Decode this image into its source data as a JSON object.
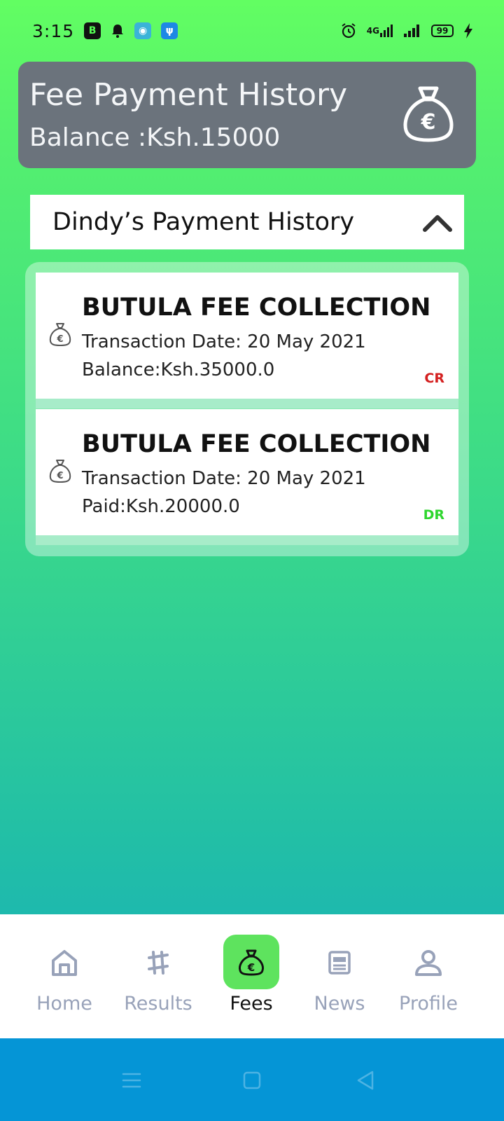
{
  "status_bar": {
    "time": "3:15",
    "network_label": "4G",
    "battery": "99"
  },
  "header": {
    "title": "Fee Payment History",
    "balance": "Balance :Ksh.15000",
    "icon": "money-bag-euro-icon"
  },
  "section": {
    "title": "Dindy’s Payment History",
    "toggle_icon": "chevron-up-icon"
  },
  "transactions": [
    {
      "title": "BUTULA FEE COLLECTION",
      "date": "Transaction Date: 20 May 2021",
      "amount": "Balance:Ksh.35000.0",
      "tag": "CR",
      "tag_color": "#d42020"
    },
    {
      "title": "BUTULA FEE COLLECTION",
      "date": "Transaction Date: 20 May 2021",
      "amount": "Paid:Ksh.20000.0",
      "tag": "DR",
      "tag_color": "#2ed62e"
    }
  ],
  "bottom_nav": {
    "items": [
      {
        "label": "Home",
        "icon": "home-icon"
      },
      {
        "label": "Results",
        "icon": "results-icon"
      },
      {
        "label": "Fees",
        "icon": "money-bag-icon",
        "active": true
      },
      {
        "label": "News",
        "icon": "news-icon"
      },
      {
        "label": "Profile",
        "icon": "profile-icon"
      }
    ]
  },
  "colors": {
    "header_bg": "#6b737c",
    "active_nav": "#5ee35e",
    "system_nav": "#0595d6"
  }
}
